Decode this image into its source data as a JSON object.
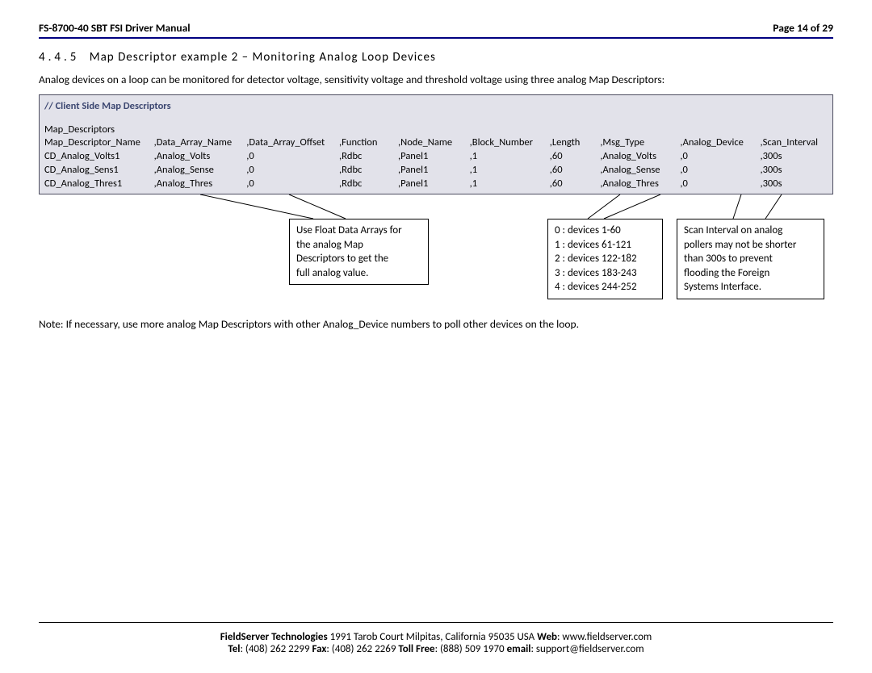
{
  "header": {
    "left": "FS-8700-40 SBT FSI Driver Manual",
    "right": "Page 14 of 29"
  },
  "section": {
    "number": "4.4.5",
    "title": "Map Descriptor example 2 – Monitoring Analog Loop Devices"
  },
  "intro": "Analog devices on a loop can be monitored for detector voltage, sensitivity voltage and threshold voltage using three analog Map Descriptors:",
  "table": {
    "comment": "//    Client Side Map Descriptors",
    "map_title": "Map_Descriptors",
    "headers": [
      "Map_Descriptor_Name",
      ",Data_Array_Name",
      ",Data_Array_Offset",
      ",Function",
      ",Node_Name",
      ",Block_Number",
      ",Length",
      ",Msg_Type",
      ",Analog_Device",
      ",Scan_Interval"
    ],
    "rows": [
      [
        "CD_Analog_Volts1",
        ",Analog_Volts",
        ",0",
        ",Rdbc",
        ",Panel1",
        ",1",
        ",60",
        ",Analog_Volts",
        ",0",
        ",300s"
      ],
      [
        "CD_Analog_Sens1",
        ",Analog_Sense",
        ",0",
        ",Rdbc",
        ",Panel1",
        ",1",
        ",60",
        ",Analog_Sense",
        ",0",
        ",300s"
      ],
      [
        "CD_Analog_Thres1",
        ",Analog_Thres",
        ",0",
        ",Rdbc",
        ",Panel1",
        ",1",
        ",60",
        ",Analog_Thres",
        ",0",
        ",300s"
      ]
    ]
  },
  "callouts": {
    "c1": {
      "l1": "Use Float Data Arrays for",
      "l2": "the analog Map",
      "l3": "Descriptors to get the",
      "l4": "full analog value."
    },
    "c2": {
      "l1": "0 : devices 1-60",
      "l2": "1 : devices 61-121",
      "l3": "2 : devices 122-182",
      "l4": "3 : devices 183-243",
      "l5": "4 : devices 244-252"
    },
    "c3": {
      "l1": "Scan Interval on analog",
      "l2": "pollers may not be shorter",
      "l3": "than 300s to prevent",
      "l4": "flooding the Foreign",
      "l5": "Systems Interface."
    }
  },
  "note": "Note: If necessary, use more analog Map Descriptors with other Analog_Device numbers to poll other devices on the loop.",
  "footer": {
    "line1_a": "FieldServer Technologies",
    "line1_b": " 1991 Tarob Court Milpitas, California 95035 USA  ",
    "line1_c": "Web",
    "line1_d": ": www.fieldserver.com",
    "line2_a": "Tel",
    "line2_b": ": (408) 262 2299  ",
    "line2_c": "Fax",
    "line2_d": ": (408) 262 2269  ",
    "line2_e": "Toll Free",
    "line2_f": ": (888) 509 1970  ",
    "line2_g": "email",
    "line2_h": ": support@fieldserver.com"
  }
}
